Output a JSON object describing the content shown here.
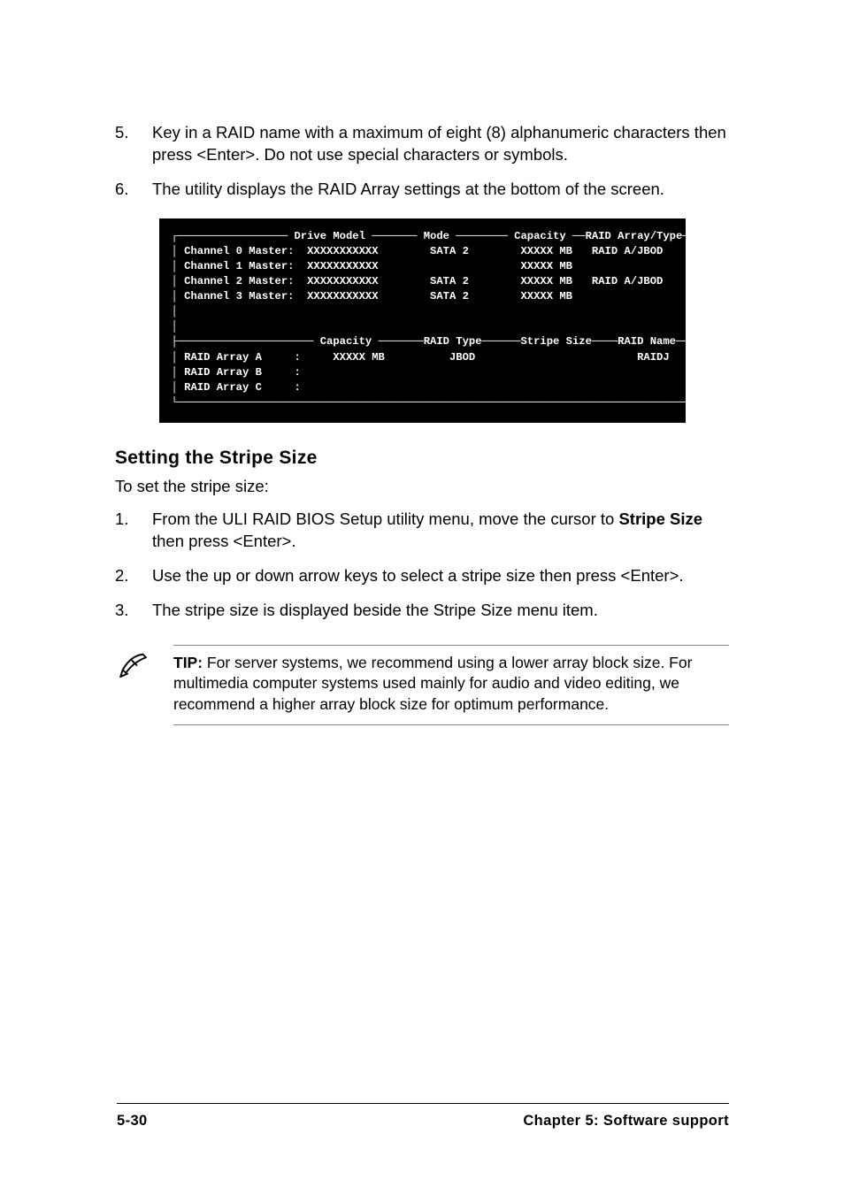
{
  "steps_upper": [
    {
      "num": "5.",
      "text": "Key in a RAID name with a maximum of eight (8) alphanumeric characters then press <Enter>. Do not use special characters or symbols."
    },
    {
      "num": "6.",
      "text": "The utility displays the RAID Array settings at the bottom of the screen."
    }
  ],
  "terminal": {
    "block": "┌───────────────── Drive Model ─────── Mode ──────── Capacity ──RAID Array/Type──┐\n│ Channel 0 Master:  XXXXXXXXXXX        SATA 2        XXXXX MB   RAID A/JBOD      │\n│ Channel 1 Master:  XXXXXXXXXXX                      XXXXX MB                    │\n│ Channel 2 Master:  XXXXXXXXXXX        SATA 2        XXXXX MB   RAID A/JBOD      │\n│ Channel 3 Master:  XXXXXXXXXXX        SATA 2        XXXXX MB                    │\n│                                                                                 │\n│                                                                                 │\n├───────────────────── Capacity ───────RAID Type──────Stripe Size────RAID Name────┤\n│ RAID Array A     :     XXXXX MB          JBOD                         RAIDJ     │\n│ RAID Array B     :                                                              │\n│ RAID Array C     :                                                              │\n└─────────────────────────────────────────────────────────────────────────────────┘"
  },
  "section_heading": "Setting the Stripe Size",
  "stripe_intro": "To set the stripe size:",
  "steps_lower": [
    {
      "num": "1.",
      "pre": "From the ULI RAID BIOS Setup utility menu, move the cursor to ",
      "strong": "Stripe Size",
      "post": " then press <Enter>."
    },
    {
      "num": "2.",
      "pre": "Use the up or down arrow keys to select a stripe size then press <Enter>.",
      "strong": "",
      "post": ""
    },
    {
      "num": "3.",
      "pre": "The stripe size is displayed beside the Stripe Size menu item.",
      "strong": "",
      "post": ""
    }
  ],
  "tip": {
    "label": "TIP:",
    "text": " For server systems, we recommend using a lower array block size. For multimedia computer systems used mainly for audio and video editing, we recommend a higher array block size for optimum performance."
  },
  "footer": {
    "page": "5-30",
    "chapter": "Chapter 5: Software support"
  }
}
